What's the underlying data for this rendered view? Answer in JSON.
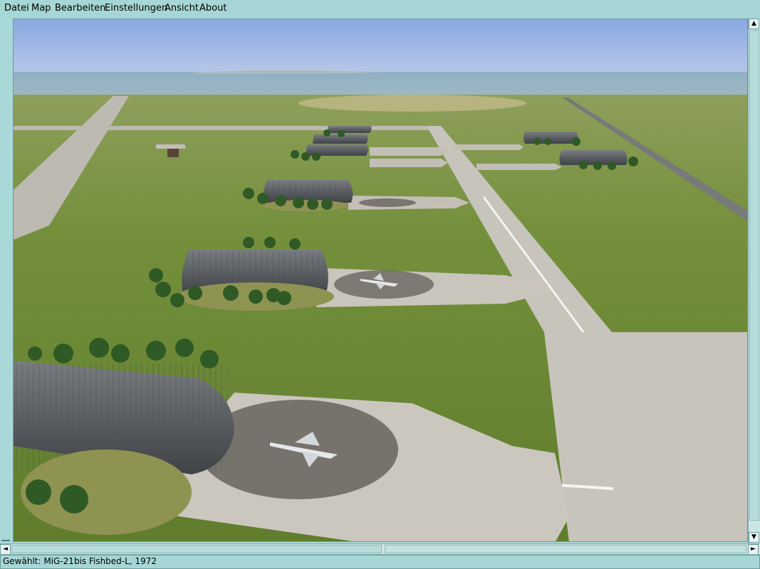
{
  "menu": {
    "items": [
      {
        "label": "Datei"
      },
      {
        "label": "Map"
      },
      {
        "label": "Bearbeiten"
      },
      {
        "label": "Einstellungen"
      },
      {
        "label": "Ansicht"
      },
      {
        "label": "About"
      }
    ]
  },
  "scene": {
    "description_icon": "3d-airbase-view"
  },
  "scrollbars": {
    "up_icon": "▲",
    "down_icon": "▼",
    "left_icon": "◄",
    "right_icon": "►"
  },
  "status": {
    "text": "Gewählt: MiG-21bis Fishbed-L, 1972"
  },
  "colors": {
    "chrome": "#a6d6d6",
    "sky": "#93aee0",
    "grass": "#6f8a3a",
    "concrete": "#c9c6c0"
  }
}
